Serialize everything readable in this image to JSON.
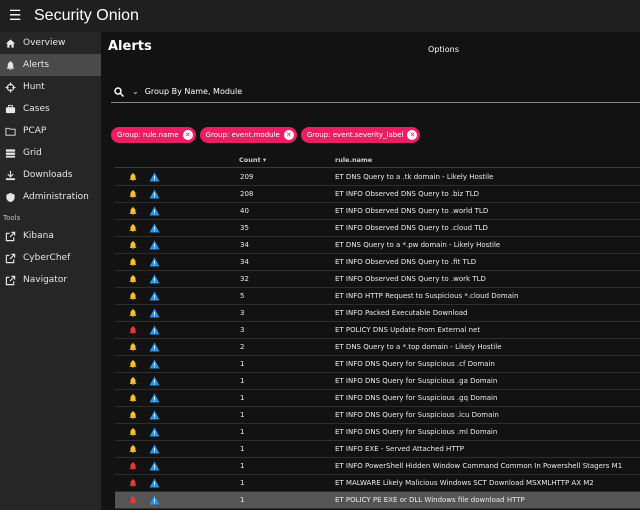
{
  "app": {
    "brand": "Security Onion"
  },
  "colors": {
    "accent": "#e91e63",
    "bell_yellow": "#fbc02d",
    "bell_red": "#e53935",
    "warn_blue": "#2196f3"
  },
  "sidebar": {
    "items": [
      {
        "label": "Overview",
        "icon": "home-icon",
        "active": false
      },
      {
        "label": "Alerts",
        "icon": "bell-icon",
        "active": true
      },
      {
        "label": "Hunt",
        "icon": "crosshairs-icon",
        "active": false
      },
      {
        "label": "Cases",
        "icon": "briefcase-icon",
        "active": false
      },
      {
        "label": "PCAP",
        "icon": "folder-icon",
        "active": false
      },
      {
        "label": "Grid",
        "icon": "grid-icon",
        "active": false
      },
      {
        "label": "Downloads",
        "icon": "download-icon",
        "active": false
      },
      {
        "label": "Administration",
        "icon": "shield-icon",
        "active": false
      }
    ],
    "tools_label": "Tools",
    "tools": [
      {
        "label": "Kibana",
        "icon": "external-link-icon"
      },
      {
        "label": "CyberChef",
        "icon": "external-link-icon"
      },
      {
        "label": "Navigator",
        "icon": "external-link-icon"
      }
    ]
  },
  "main": {
    "title": "Alerts",
    "options_label": "Options",
    "query_text": "Group By Name, Module",
    "chips": [
      {
        "label": "Group: rule.name"
      },
      {
        "label": "Group: event.module"
      },
      {
        "label": "Group: event.severity_label"
      }
    ],
    "table": {
      "headers": {
        "count": "Count",
        "name": "rule.name"
      },
      "rows": [
        {
          "severity": "yellow",
          "count": "209",
          "name": "ET DNS Query to a .tk domain - Likely Hostile"
        },
        {
          "severity": "yellow",
          "count": "208",
          "name": "ET INFO Observed DNS Query to .biz TLD"
        },
        {
          "severity": "yellow",
          "count": "40",
          "name": "ET INFO Observed DNS Query to .world TLD"
        },
        {
          "severity": "yellow",
          "count": "35",
          "name": "ET INFO Observed DNS Query to .cloud TLD"
        },
        {
          "severity": "yellow",
          "count": "34",
          "name": "ET DNS Query to a *.pw domain - Likely Hostile"
        },
        {
          "severity": "yellow",
          "count": "34",
          "name": "ET INFO Observed DNS Query to .fit TLD"
        },
        {
          "severity": "yellow",
          "count": "32",
          "name": "ET INFO Observed DNS Query to .work TLD"
        },
        {
          "severity": "yellow",
          "count": "5",
          "name": "ET INFO HTTP Request to Suspicious *.cloud Domain"
        },
        {
          "severity": "yellow",
          "count": "3",
          "name": "ET INFO Packed Executable Download"
        },
        {
          "severity": "red",
          "count": "3",
          "name": "ET POLICY DNS Update From External net"
        },
        {
          "severity": "yellow",
          "count": "2",
          "name": "ET DNS Query to a *.top domain - Likely Hostile"
        },
        {
          "severity": "yellow",
          "count": "1",
          "name": "ET INFO DNS Query for Suspicious .cf Domain"
        },
        {
          "severity": "yellow",
          "count": "1",
          "name": "ET INFO DNS Query for Suspicious .ga Domain"
        },
        {
          "severity": "yellow",
          "count": "1",
          "name": "ET INFO DNS Query for Suspicious .gq Domain"
        },
        {
          "severity": "yellow",
          "count": "1",
          "name": "ET INFO DNS Query for Suspicious .icu Domain"
        },
        {
          "severity": "yellow",
          "count": "1",
          "name": "ET INFO DNS Query for Suspicious .ml Domain"
        },
        {
          "severity": "yellow",
          "count": "1",
          "name": "ET INFO EXE - Served Attached HTTP"
        },
        {
          "severity": "red",
          "count": "1",
          "name": "ET INFO PowerShell Hidden Window Command Common In Powershell Stagers M1"
        },
        {
          "severity": "red",
          "count": "1",
          "name": "ET MALWARE Likely Malicious Windows SCT Download MSXMLHTTP AX M2"
        },
        {
          "severity": "red",
          "count": "1",
          "name": "ET POLICY PE EXE or DLL Windows file download HTTP",
          "highlight": true
        }
      ]
    }
  }
}
